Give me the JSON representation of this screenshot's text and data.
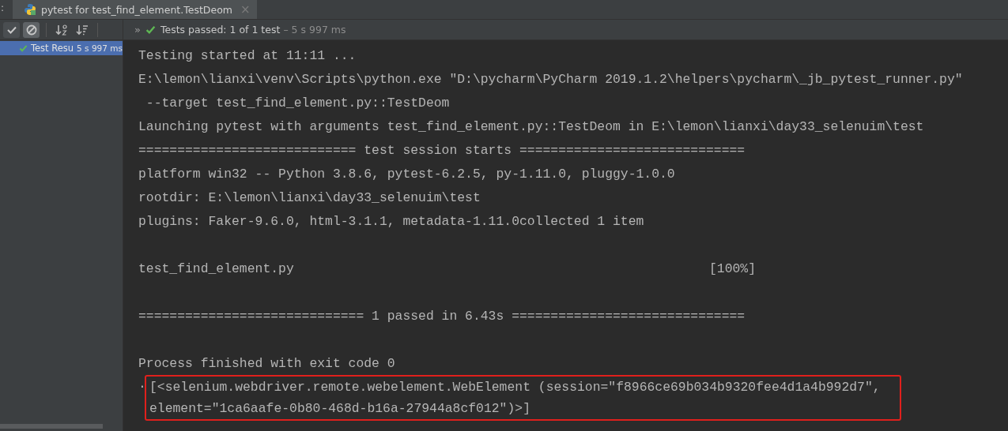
{
  "tab_bar": {
    "edge_text": ":",
    "tabs": [
      {
        "title": "pytest for test_find_element.TestDeom",
        "selected": true,
        "close": "×"
      }
    ]
  },
  "toolbar": {
    "toggles": [
      {
        "kind": "check",
        "on": true
      },
      {
        "kind": "ignore",
        "on": true
      }
    ],
    "sorts": [
      {
        "kind": "alpha"
      },
      {
        "kind": "duration"
      }
    ],
    "more": "»",
    "status": "Tests passed: 1 of 1 test",
    "duration": "– 5 s 997 ms"
  },
  "tree": {
    "items": [
      {
        "label": "Test Resu",
        "time": "5 s 997 ms",
        "passed": true,
        "selected": true
      }
    ]
  },
  "console": {
    "blocks": [
      {
        "kind": "plain",
        "lines": [
          "Testing started at 11:11 ...",
          "E:\\lemon\\lianxi\\venv\\Scripts\\python.exe \"D:\\pycharm\\PyCharm 2019.1.2\\helpers\\pycharm\\_jb_pytest_runner.py\"",
          " --target test_find_element.py::TestDeom",
          "Launching pytest with arguments test_find_element.py::TestDeom in E:\\lemon\\lianxi\\day33_selenuim\\test",
          "============================ test session starts =============================",
          "platform win32 -- Python 3.8.6, pytest-6.2.5, py-1.11.0, pluggy-1.0.0",
          "rootdir: E:\\lemon\\lianxi\\day33_selenuim\\test",
          "plugins: Faker-9.6.0, html-3.1.1, metadata-1.11.0collected 1 item"
        ]
      },
      {
        "kind": "progress",
        "file": "test_find_element.py",
        "percent": "[100%]"
      },
      {
        "kind": "plain",
        "lines": [
          "============================= 1 passed in 6.43s =============================="
        ]
      },
      {
        "kind": "plain",
        "lines": [
          "Process finished with exit code 0"
        ]
      },
      {
        "kind": "highlighted",
        "prefix": ".",
        "lines": [
          "[<selenium.webdriver.remote.webelement.WebElement (session=\"f8966ce69b034b9320fee4d1a4b992d7\",",
          "element=\"1ca6aafe-0b80-468d-b16a-27944a8cf012\")>]"
        ]
      }
    ]
  }
}
